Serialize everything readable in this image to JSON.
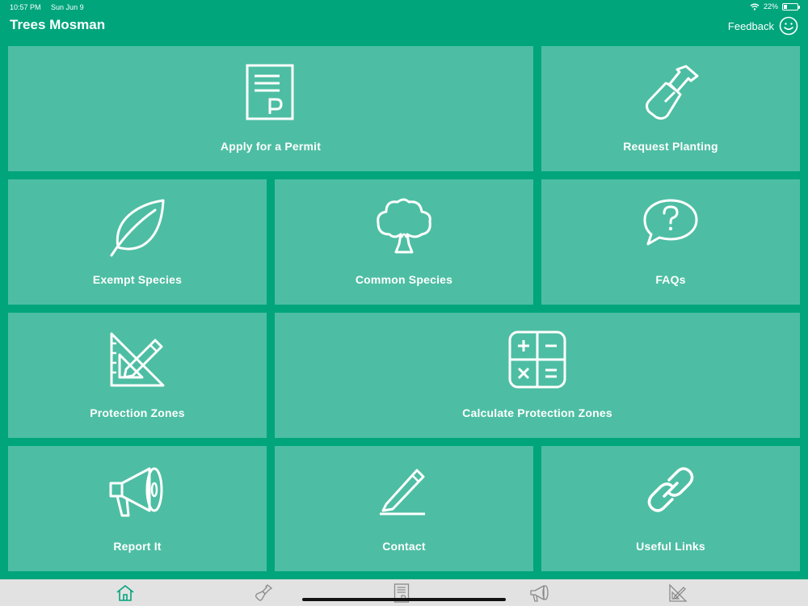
{
  "status_bar": {
    "time": "10:57 PM",
    "date": "Sun Jun 9",
    "battery": "22%",
    "battery_level": 0.22
  },
  "header": {
    "title": "Trees Mosman",
    "feedback_label": "Feedback"
  },
  "tiles": [
    {
      "label": "Apply for a Permit",
      "icon": "permit-document-icon"
    },
    {
      "label": "Request Planting",
      "icon": "shovel-icon"
    },
    {
      "label": "Exempt Species",
      "icon": "leaf-icon"
    },
    {
      "label": "Common Species",
      "icon": "tree-icon"
    },
    {
      "label": "FAQs",
      "icon": "question-bubble-icon"
    },
    {
      "label": "Protection Zones",
      "icon": "set-square-pencil-icon"
    },
    {
      "label": "Calculate Protection Zones",
      "icon": "calculator-icon"
    },
    {
      "label": "Report It",
      "icon": "megaphone-icon"
    },
    {
      "label": "Contact",
      "icon": "pencil-icon"
    },
    {
      "label": "Useful Links",
      "icon": "link-icon"
    }
  ],
  "tab_bar": [
    {
      "icon": "home-icon",
      "active": true
    },
    {
      "icon": "shovel-icon",
      "active": false
    },
    {
      "icon": "permit-document-icon",
      "active": false
    },
    {
      "icon": "megaphone-icon",
      "active": false
    },
    {
      "icon": "set-square-pencil-icon",
      "active": false
    }
  ],
  "colors": {
    "background": "#00a57c",
    "tile": "#4dbea3",
    "tab_bar": "#e2e2e2",
    "tab_active": "#00a57c",
    "tab_inactive": "#8a8a8a"
  }
}
